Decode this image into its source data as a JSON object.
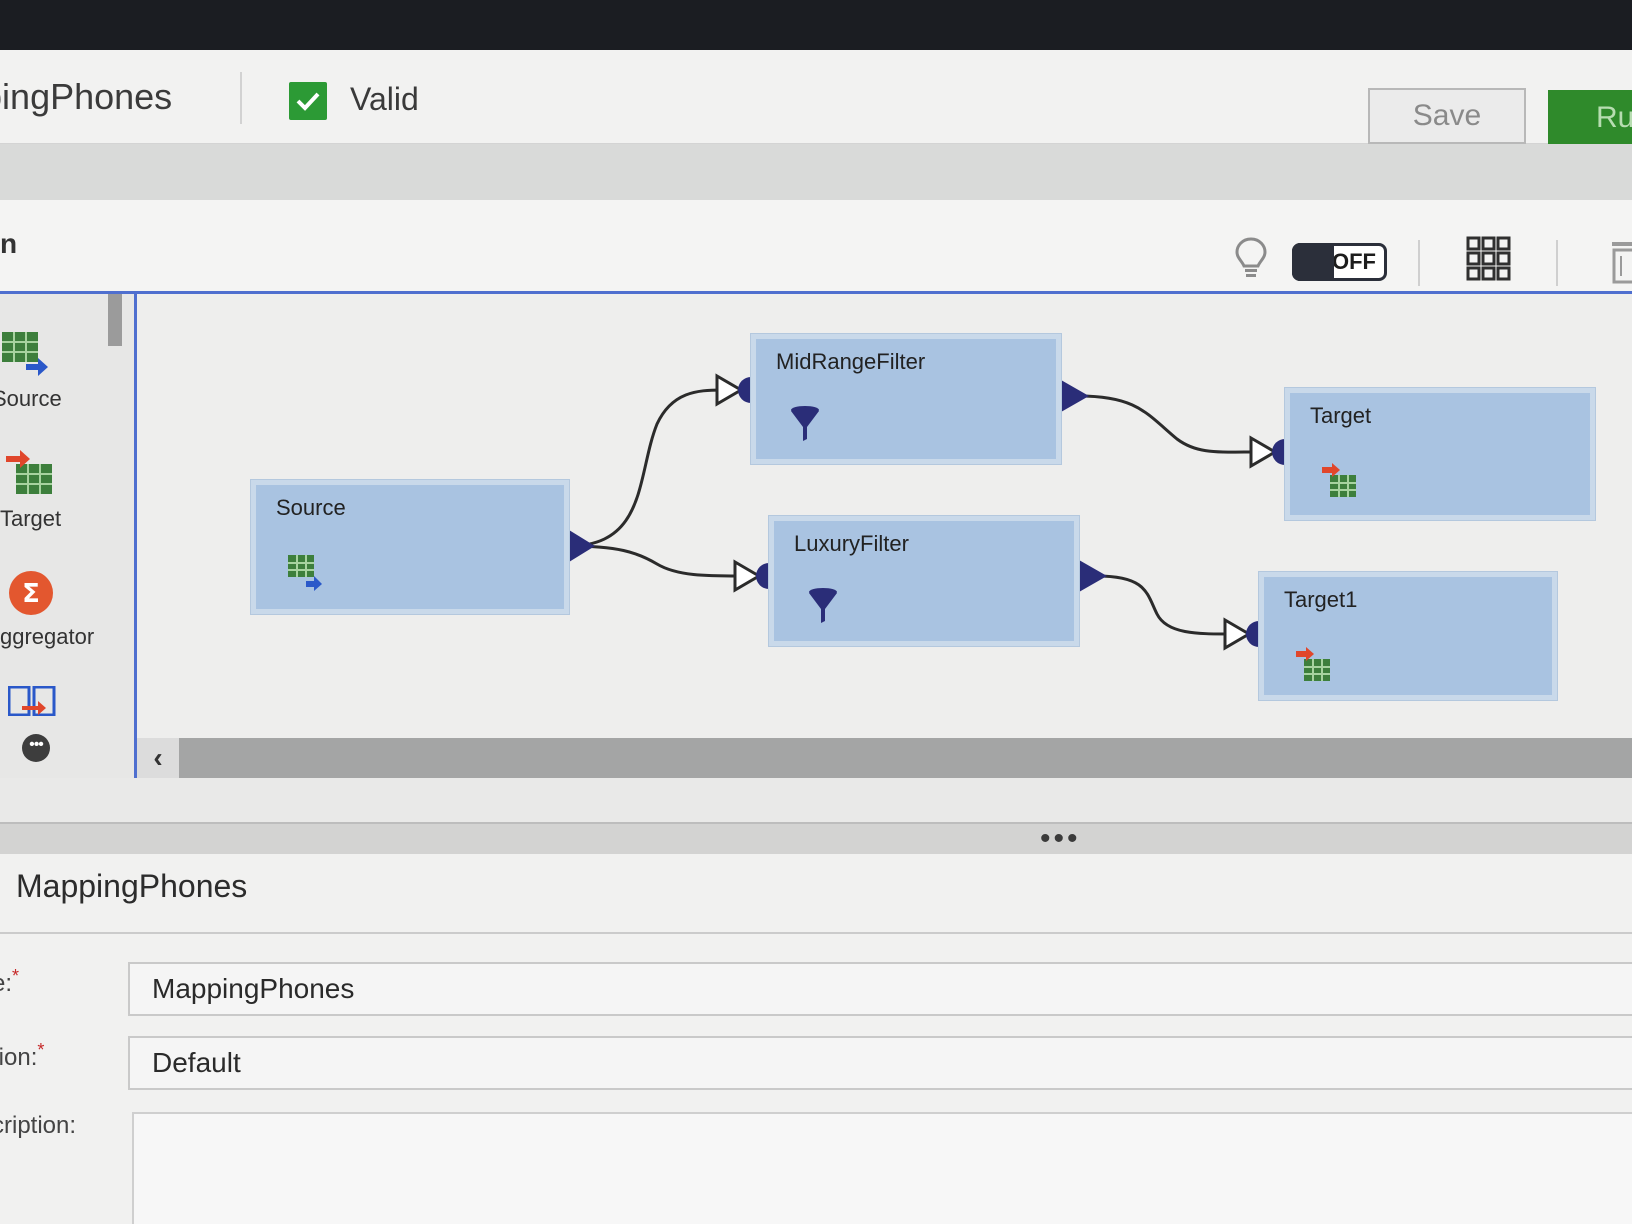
{
  "header": {
    "title": "ppingPhones",
    "status_label": "Valid",
    "save_label": "Save",
    "run_label": "Run"
  },
  "toolbar": {
    "panel_title": "n",
    "toggle_label": "OFF"
  },
  "palette": {
    "items": [
      {
        "label": "Source",
        "icon": "source-icon"
      },
      {
        "label": "Target",
        "icon": "target-icon"
      },
      {
        "label": "ggregator",
        "icon": "aggregator-icon"
      },
      {
        "label": "",
        "icon": "expression-icon"
      }
    ]
  },
  "canvas": {
    "nodes": [
      {
        "id": "source",
        "label": "Source",
        "icon": "source-table-icon"
      },
      {
        "id": "midrange",
        "label": "MidRangeFilter",
        "icon": "filter-funnel-icon"
      },
      {
        "id": "luxury",
        "label": "LuxuryFilter",
        "icon": "filter-funnel-icon"
      },
      {
        "id": "target",
        "label": "Target",
        "icon": "target-table-icon"
      },
      {
        "id": "target1",
        "label": "Target1",
        "icon": "target-table-icon"
      }
    ],
    "links": [
      {
        "from": "Source",
        "to": "MidRangeFilter"
      },
      {
        "from": "Source",
        "to": "LuxuryFilter"
      },
      {
        "from": "MidRangeFilter",
        "to": "Target"
      },
      {
        "from": "LuxuryFilter",
        "to": "Target1"
      }
    ]
  },
  "properties": {
    "title": "MappingPhones",
    "fields": [
      {
        "label": "e:",
        "required": "*",
        "value": "MappingPhones"
      },
      {
        "label": "tion:",
        "required": "*",
        "value": "Default"
      },
      {
        "label": "cription:",
        "required": "",
        "value": ""
      }
    ]
  },
  "colors": {
    "accent_blue": "#4f6fcf",
    "valid_green": "#2c9a35",
    "run_green": "#2f8a2b",
    "node_fill": "#a9c3e1",
    "port_navy": "#2a2d78"
  }
}
